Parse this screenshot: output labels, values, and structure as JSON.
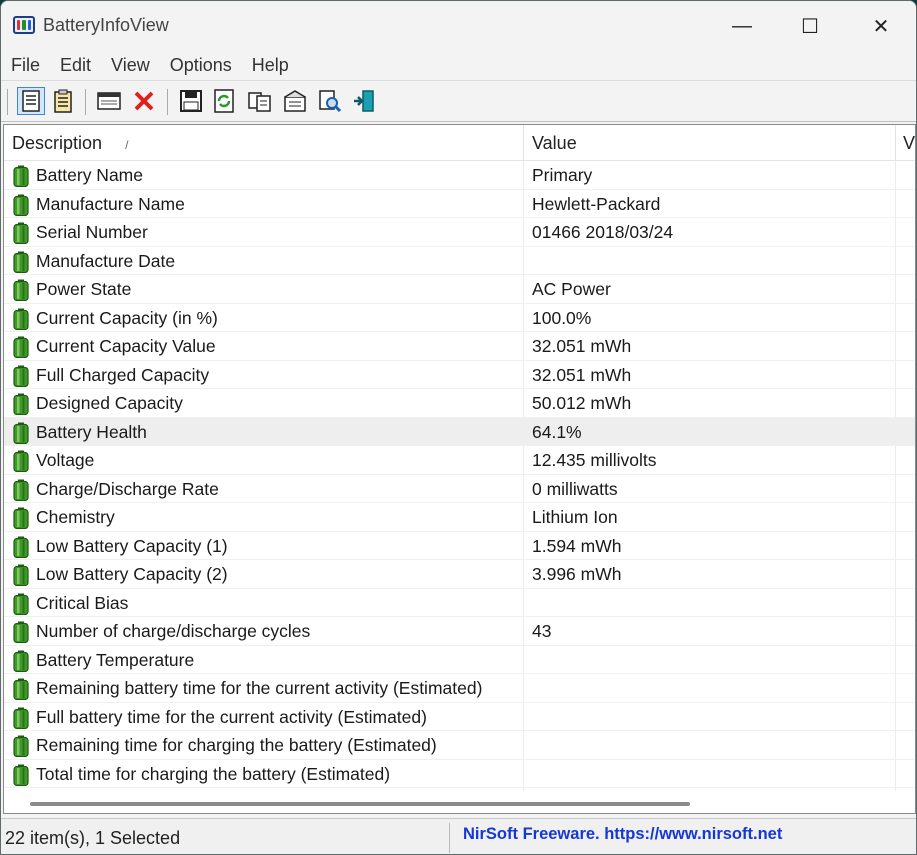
{
  "window": {
    "title": "BatteryInfoView",
    "min_glyph": "—",
    "max_glyph": "☐",
    "close_glyph": "✕"
  },
  "menu": [
    "File",
    "Edit",
    "View",
    "Options",
    "Help"
  ],
  "toolbar_icons": [
    "properties-icon",
    "html-report-icon",
    "window-icon",
    "delete-icon",
    "save-icon",
    "refresh-icon",
    "copy-icon",
    "options-icon",
    "find-icon",
    "exit-icon"
  ],
  "columns": {
    "description": "Description",
    "sort_glyph": "/",
    "value": "Value",
    "third": "V"
  },
  "rows": [
    {
      "description": "Battery Name",
      "value": "Primary"
    },
    {
      "description": "Manufacture Name",
      "value": "Hewlett-Packard"
    },
    {
      "description": "Serial Number",
      "value": "01466 2018/03/24"
    },
    {
      "description": "Manufacture Date",
      "value": ""
    },
    {
      "description": "Power State",
      "value": "AC Power"
    },
    {
      "description": "Current Capacity (in %)",
      "value": "100.0%"
    },
    {
      "description": "Current Capacity Value",
      "value": "32.051 mWh"
    },
    {
      "description": "Full Charged Capacity",
      "value": "32.051 mWh"
    },
    {
      "description": "Designed Capacity",
      "value": "50.012 mWh"
    },
    {
      "description": "Battery Health",
      "value": "64.1%",
      "selected": true
    },
    {
      "description": "Voltage",
      "value": "12.435 millivolts"
    },
    {
      "description": "Charge/Discharge Rate",
      "value": "0 milliwatts"
    },
    {
      "description": "Chemistry",
      "value": "Lithium Ion"
    },
    {
      "description": "Low Battery Capacity (1)",
      "value": "1.594 mWh"
    },
    {
      "description": "Low Battery Capacity (2)",
      "value": "3.996 mWh"
    },
    {
      "description": "Critical Bias",
      "value": ""
    },
    {
      "description": "Number of charge/discharge cycles",
      "value": "43"
    },
    {
      "description": "Battery Temperature",
      "value": ""
    },
    {
      "description": "Remaining battery time for the current activity (Estimated)",
      "value": ""
    },
    {
      "description": "Full battery time for the current activity (Estimated)",
      "value": ""
    },
    {
      "description": "Remaining time for charging the battery (Estimated)",
      "value": ""
    },
    {
      "description": "Total  time for charging the battery (Estimated)",
      "value": ""
    }
  ],
  "status": {
    "count": "22 item(s), 1 Selected",
    "link": "NirSoft Freeware. https://www.nirsoft.net"
  },
  "colors": {
    "battery_green": "#3f9a2a",
    "battery_dark": "#1e5a12",
    "link_blue": "#1538d4",
    "selection": "#eeeeee"
  }
}
